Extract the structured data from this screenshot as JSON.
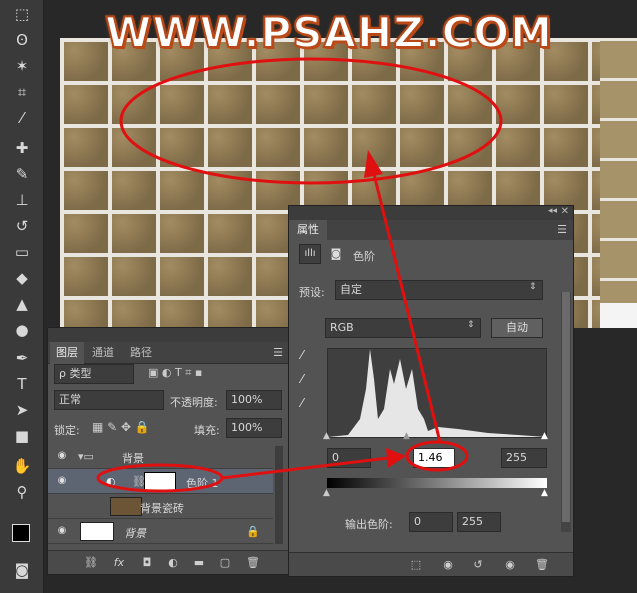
{
  "watermark": "WWW.PSAHZ.COM",
  "toolbar": {
    "icons": [
      "marquee-icon",
      "lasso-icon",
      "magic-wand-icon",
      "crop-icon",
      "eyedropper-icon",
      "healing-brush-icon",
      "brush-icon",
      "clone-stamp-icon",
      "history-brush-icon",
      "eraser-icon",
      "paint-bucket-icon",
      "blur-icon",
      "dodge-icon",
      "pen-icon",
      "type-icon",
      "path-select-icon",
      "rectangle-icon",
      "hand-icon",
      "zoom-icon"
    ],
    "type_glyph": "T"
  },
  "layers_panel": {
    "tabs": [
      "图层",
      "通道",
      "路径"
    ],
    "kind_filter": "ρ 类型",
    "blend_mode": "正常",
    "opacity_label": "不透明度:",
    "opacity_value": "100%",
    "lock_label": "锁定:",
    "fill_label": "填充:",
    "fill_value": "100%",
    "layers": [
      {
        "name": "背景",
        "type": "group"
      },
      {
        "name": "色阶 1",
        "type": "adjustment"
      },
      {
        "name": "背景瓷砖",
        "type": "pixel"
      },
      {
        "name": "背景",
        "type": "background"
      }
    ],
    "bottom_fx": "fx"
  },
  "properties_panel": {
    "title": "属性",
    "heading": "色阶",
    "preset_label": "预设:",
    "preset_value": "自定",
    "channel": "RGB",
    "auto_button": "自动",
    "input_black": "0",
    "input_gamma": "1.46",
    "input_white": "255",
    "output_label": "输出色阶:",
    "output_black": "0",
    "output_white": "255"
  },
  "colors": {
    "annotation_red": "#e01010",
    "panel_bg": "#535353",
    "watermark_outline": "#b84818"
  }
}
